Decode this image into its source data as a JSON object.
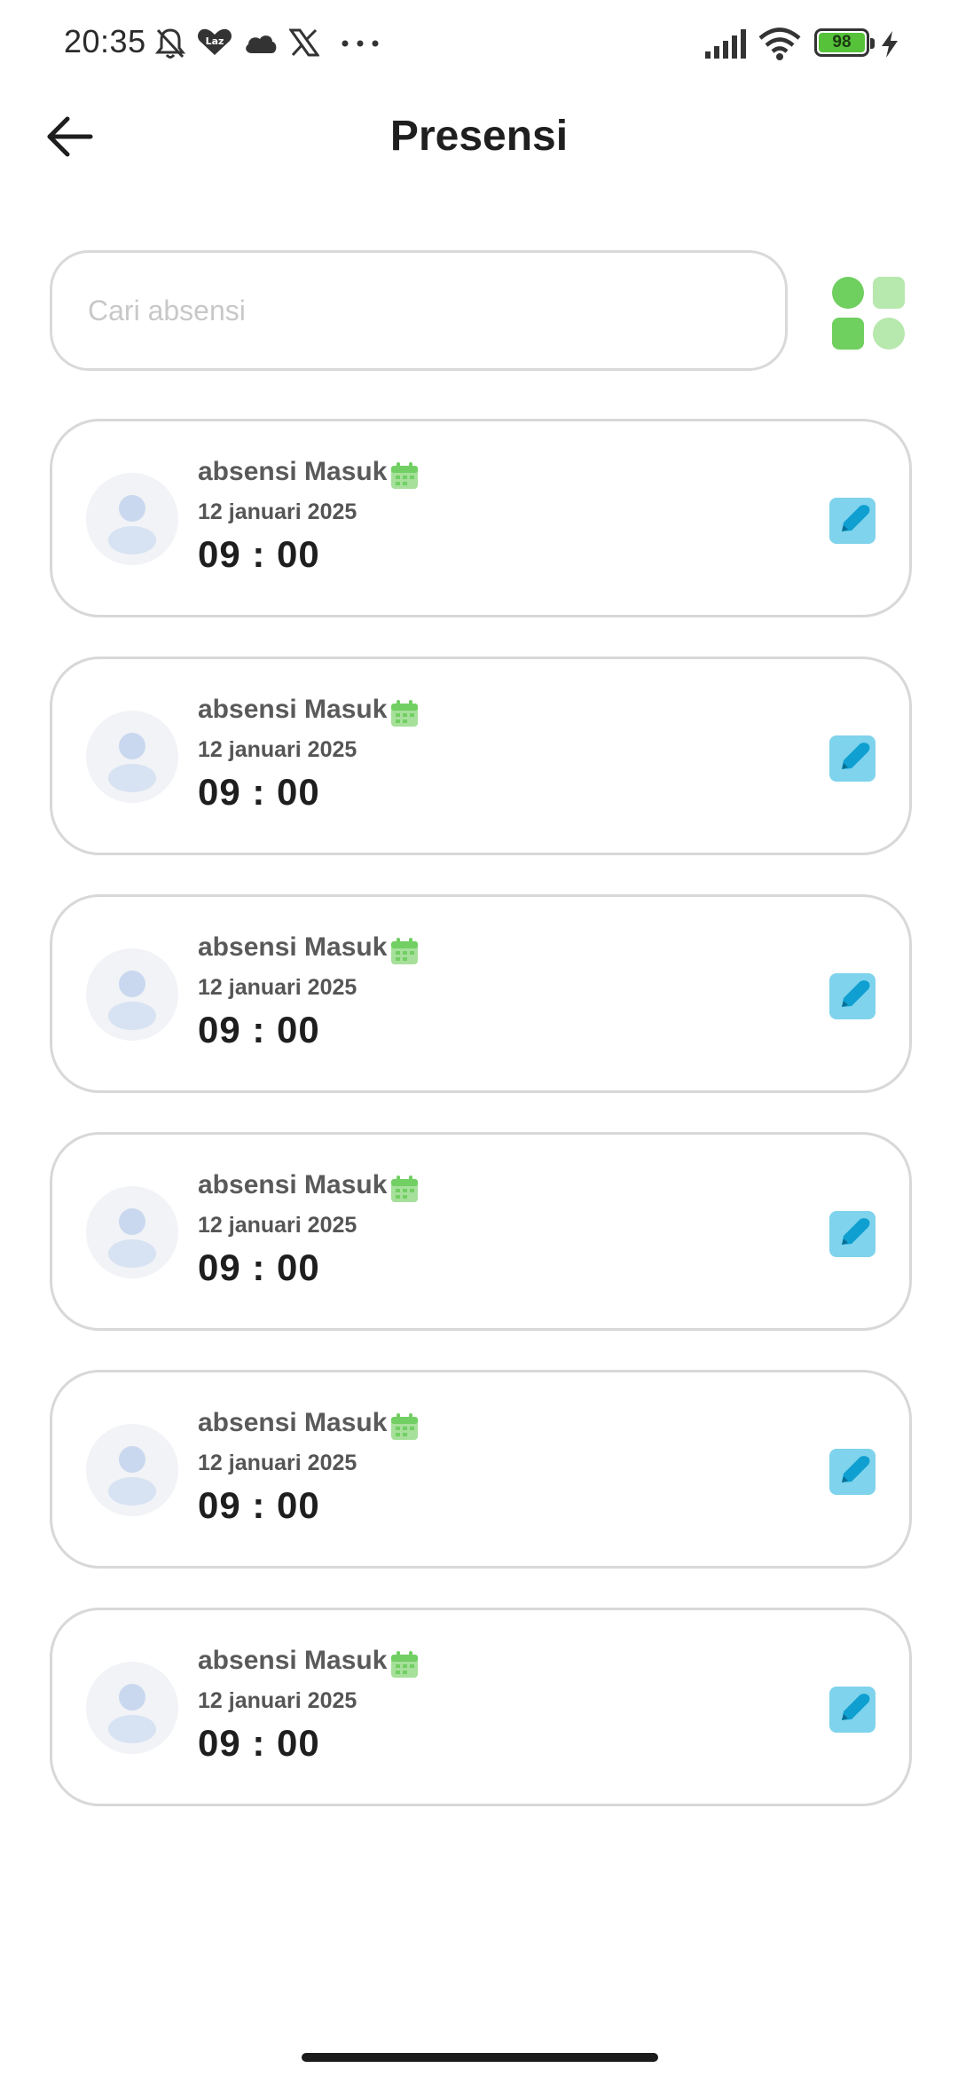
{
  "status_bar": {
    "time": "20:35",
    "battery": "98",
    "icons": [
      "bell-off-icon",
      "lazada-icon",
      "cloud-icon",
      "x-icon",
      "more-icon",
      "signal-icon",
      "wifi-icon",
      "battery-icon",
      "charging-icon"
    ]
  },
  "header": {
    "title": "Presensi",
    "back_icon": "arrow-left-icon"
  },
  "search": {
    "placeholder": "Cari absensi",
    "value": "",
    "grid_icon": "grid-view-icon"
  },
  "colors": {
    "accent_green": "#6fcf5f",
    "edit_blue": "#7fd3ec",
    "card_border": "#d8d8d8"
  },
  "items": [
    {
      "title": "absensi Masuk",
      "date": "12 januari 2025",
      "time": "09 : 00"
    },
    {
      "title": "absensi Masuk",
      "date": "12 januari 2025",
      "time": "09 : 00"
    },
    {
      "title": "absensi Masuk",
      "date": "12 januari 2025",
      "time": "09 : 00"
    },
    {
      "title": "absensi Masuk",
      "date": "12 januari 2025",
      "time": "09 : 00"
    },
    {
      "title": "absensi Masuk",
      "date": "12 januari 2025",
      "time": "09 : 00"
    },
    {
      "title": "absensi Masuk",
      "date": "12 januari 2025",
      "time": "09 : 00"
    }
  ]
}
